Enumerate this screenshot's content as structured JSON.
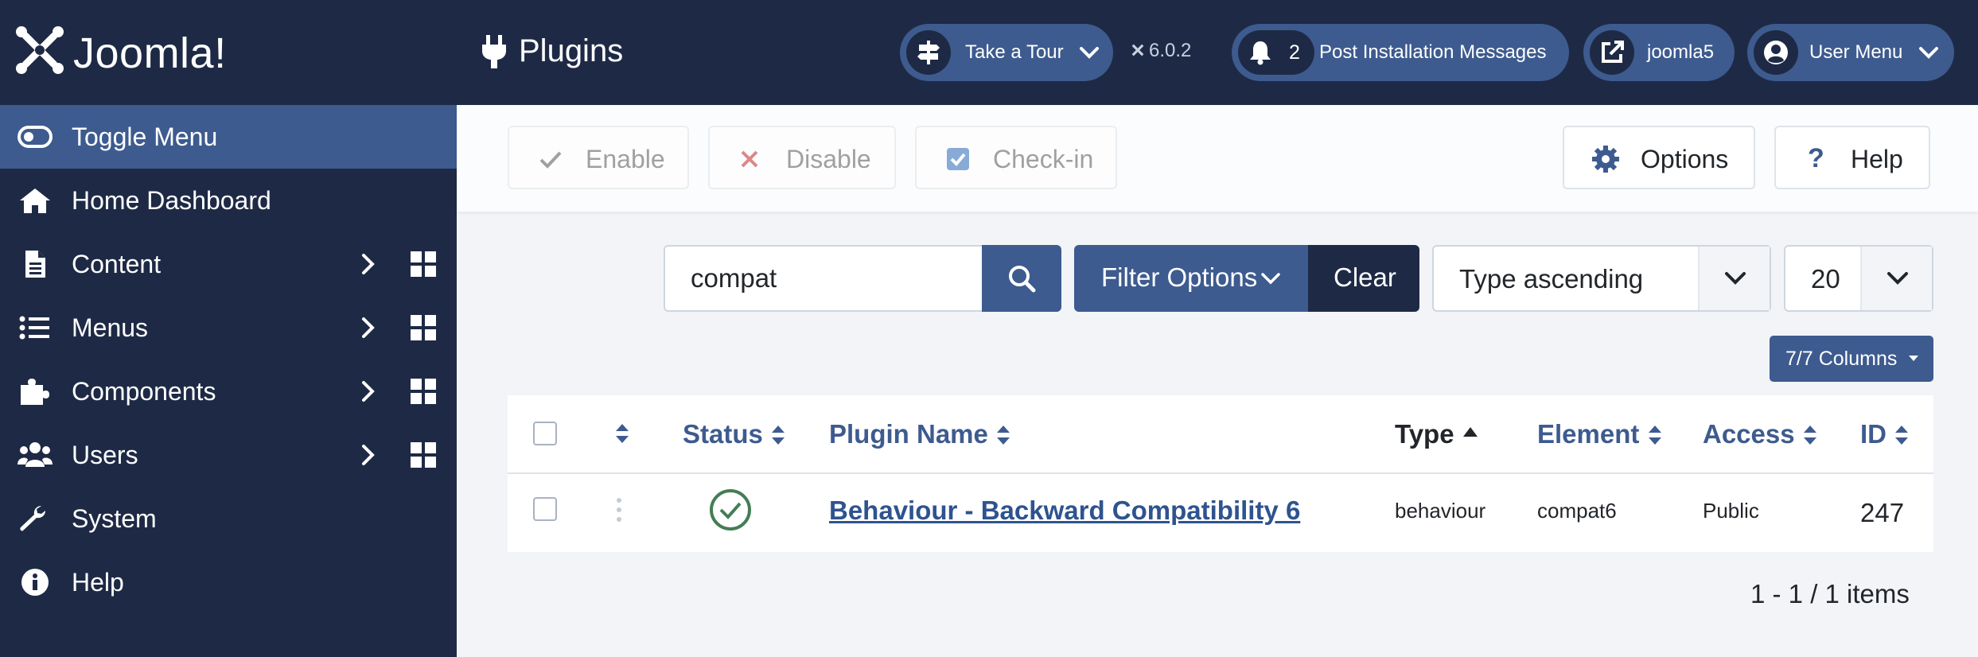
{
  "brand": {
    "name": "Joomla!"
  },
  "sidebar": {
    "toggle_label": "Toggle Menu",
    "items": [
      {
        "label": "Home Dashboard",
        "icon": "home-icon"
      },
      {
        "label": "Content",
        "icon": "file-icon",
        "has_submenu": true
      },
      {
        "label": "Menus",
        "icon": "list-icon",
        "has_submenu": true
      },
      {
        "label": "Components",
        "icon": "puzzle-icon",
        "has_submenu": true
      },
      {
        "label": "Users",
        "icon": "users-icon",
        "has_submenu": true
      },
      {
        "label": "System",
        "icon": "wrench-icon"
      },
      {
        "label": "Help",
        "icon": "info-icon"
      }
    ]
  },
  "header": {
    "title": "Plugins",
    "tour_label": "Take a Tour",
    "version": "6.0.2",
    "notification_count": "2",
    "post_install_label": "Post Installation Messages",
    "site_label": "joomla5",
    "user_menu_label": "User Menu"
  },
  "toolbar": {
    "enable_label": "Enable",
    "disable_label": "Disable",
    "checkin_label": "Check-in",
    "options_label": "Options",
    "help_label": "Help"
  },
  "filters": {
    "search_value": "compat",
    "filter_options_label": "Filter Options",
    "clear_label": "Clear",
    "sort_value": "Type ascending",
    "limit_value": "20",
    "columns_label": "7/7 Columns"
  },
  "table": {
    "headers": {
      "status": "Status",
      "name": "Plugin Name",
      "type": "Type",
      "element": "Element",
      "access": "Access",
      "id": "ID"
    },
    "rows": [
      {
        "name": "Behaviour - Backward Compatibility 6",
        "type": "behaviour",
        "element": "compat6",
        "access": "Public",
        "id": "247",
        "enabled": true
      }
    ]
  },
  "pagination": {
    "summary": "1 - 1 / 1 items"
  },
  "colors": {
    "sidebar": "#1e2a45",
    "accent": "#3d5b8f",
    "enabled_green": "#457d54"
  }
}
